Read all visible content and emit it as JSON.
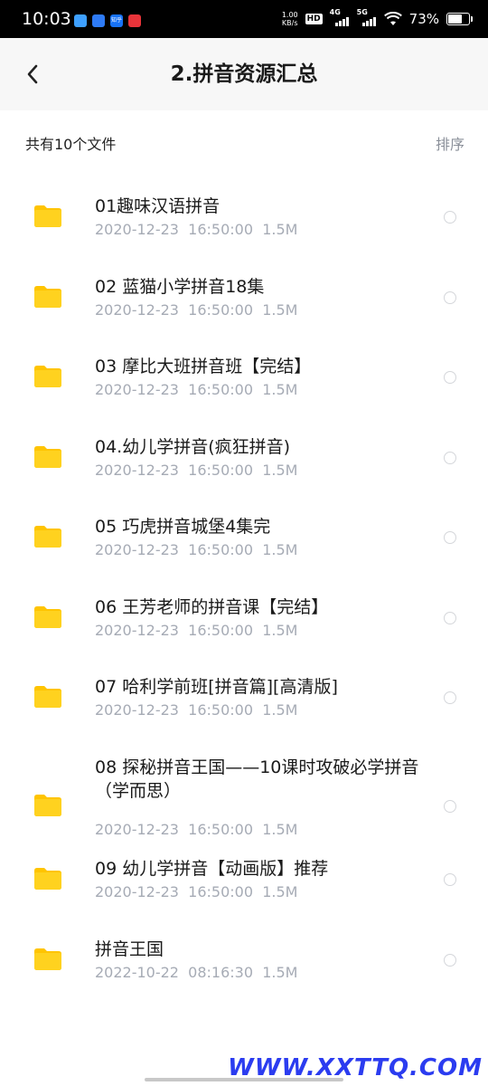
{
  "status_bar": {
    "time": "10:03",
    "apps": [
      {
        "label": "",
        "color": "#3ea0ff"
      },
      {
        "label": "",
        "color": "#2e7bf6"
      },
      {
        "label": "知乎",
        "color": "#1772f6"
      },
      {
        "label": "",
        "color": "#e8343a"
      }
    ],
    "net_speed_value": "1.00",
    "net_speed_unit": "KB/s",
    "hd_label": "HD",
    "signal_1_label": "4G",
    "signal_2_label": "5G",
    "battery_percent": "73%",
    "battery_level": 0.73
  },
  "header": {
    "title": "2.拼音资源汇总"
  },
  "list_header": {
    "file_count": "共有10个文件",
    "sort_label": "排序"
  },
  "files": [
    {
      "name": "01趣味汉语拼音",
      "meta": "2020-12-23  16:50:00  1.5M"
    },
    {
      "name": "02 蓝猫小学拼音18集",
      "meta": "2020-12-23  16:50:00  1.5M"
    },
    {
      "name": "03 摩比大班拼音班【完结】",
      "meta": "2020-12-23  16:50:00  1.5M"
    },
    {
      "name": "04.幼儿学拼音(疯狂拼音)",
      "meta": "2020-12-23  16:50:00  1.5M"
    },
    {
      "name": "05 巧虎拼音城堡4集完",
      "meta": "2020-12-23  16:50:00  1.5M"
    },
    {
      "name": "06 王芳老师的拼音课【完结】",
      "meta": "2020-12-23  16:50:00  1.5M"
    },
    {
      "name": "07 哈利学前班[拼音篇][高清版]",
      "meta": "2020-12-23  16:50:00  1.5M"
    },
    {
      "name": "08 探秘拼音王国——10课时攻破必学拼音（学而思）",
      "meta": "2020-12-23  16:50:00  1.5M"
    },
    {
      "name": "09 幼儿学拼音【动画版】推荐",
      "meta": "2020-12-23  16:50:00  1.5M"
    },
    {
      "name": "拼音王国",
      "meta": "2022-10-22  08:16:30  1.5M"
    }
  ],
  "watermark": "WWW.XXTTQ.COM",
  "colors": {
    "folder": "#ffd21f",
    "folder_tab": "#ffc400",
    "watermark": "#2b3cf0"
  }
}
